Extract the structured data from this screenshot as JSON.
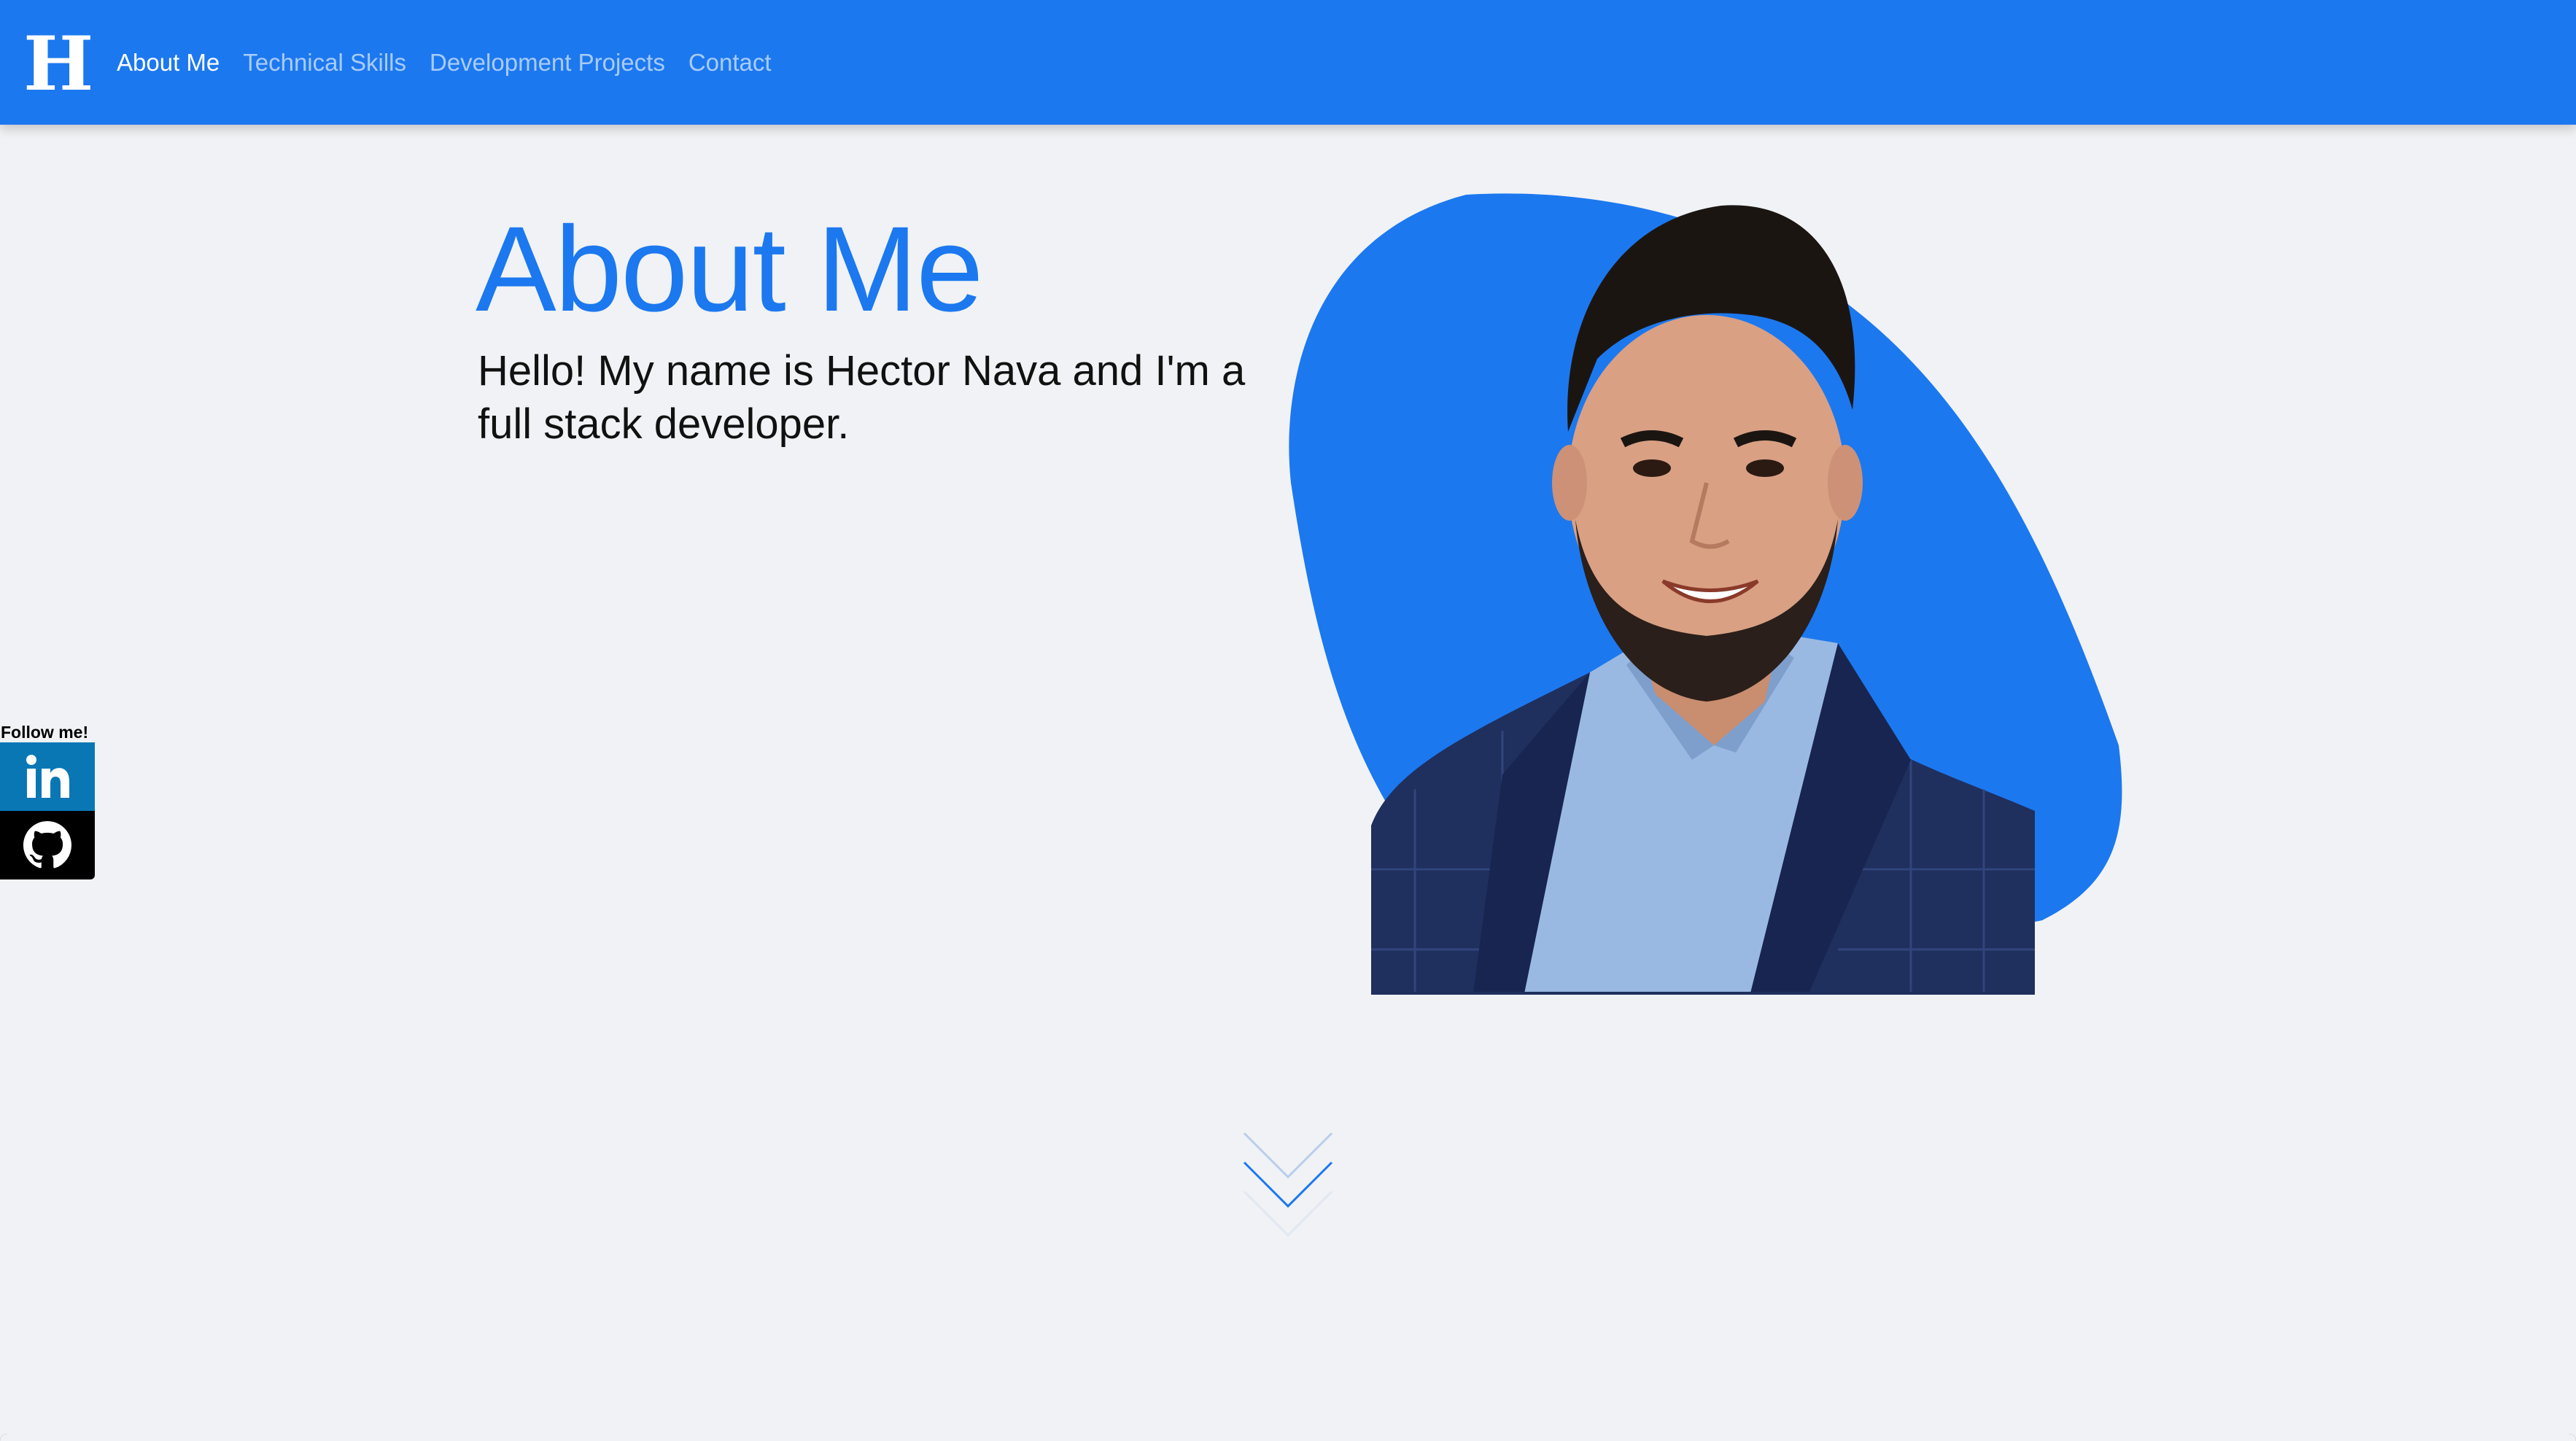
{
  "navbar": {
    "brand": "H",
    "links": [
      {
        "label": "About Me",
        "active": true
      },
      {
        "label": "Technical Skills",
        "active": false
      },
      {
        "label": "Development Projects",
        "active": false
      },
      {
        "label": "Contact",
        "active": false
      }
    ]
  },
  "hero": {
    "title": "About Me",
    "intro": "Hello! My name is Hector Nava and I'm a full stack developer."
  },
  "social": {
    "follow_label": "Follow me!",
    "items": [
      {
        "name": "linkedin",
        "icon": "linkedin-icon",
        "color": "#0a77b5"
      },
      {
        "name": "github",
        "icon": "github-icon",
        "color": "#000000"
      }
    ]
  },
  "colors": {
    "accent": "#1c78ef",
    "background": "#f0f2f5",
    "text": "#111111"
  },
  "scroll_indicator": {
    "icon": "chevron-down-icon"
  }
}
